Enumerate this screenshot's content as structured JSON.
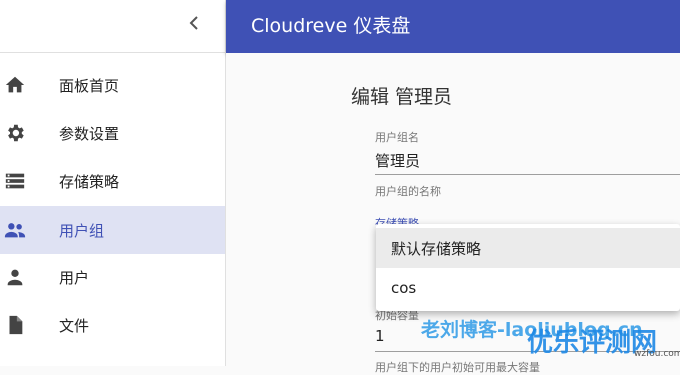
{
  "app": {
    "title": "Cloudreve 仪表盘"
  },
  "sidebar": {
    "items": [
      {
        "label": "面板首页",
        "icon": "home-icon"
      },
      {
        "label": "参数设置",
        "icon": "gear-icon"
      },
      {
        "label": "存储策略",
        "icon": "storage-icon"
      },
      {
        "label": "用户组",
        "icon": "group-icon",
        "active": true
      },
      {
        "label": "用户",
        "icon": "person-icon"
      },
      {
        "label": "文件",
        "icon": "file-icon"
      }
    ]
  },
  "form": {
    "title": "编辑 管理员",
    "name_label": "用户组名",
    "name_value": "管理员",
    "name_helper": "用户组的名称",
    "policy_label": "存储策略",
    "quota_label": "初始容量",
    "quota_value": "1",
    "quota_helper": "用户组下的用户初始可用最大容量"
  },
  "policy_menu": {
    "options": [
      "默认存储策略",
      "cos"
    ]
  },
  "watermark": {
    "line1": "老刘博客-laoliublog.cn",
    "line2": "优乐评测网",
    "line3": "wzfou.com"
  },
  "colors": {
    "primary": "#3f51b5",
    "active_bg": "#dfe2f3"
  }
}
